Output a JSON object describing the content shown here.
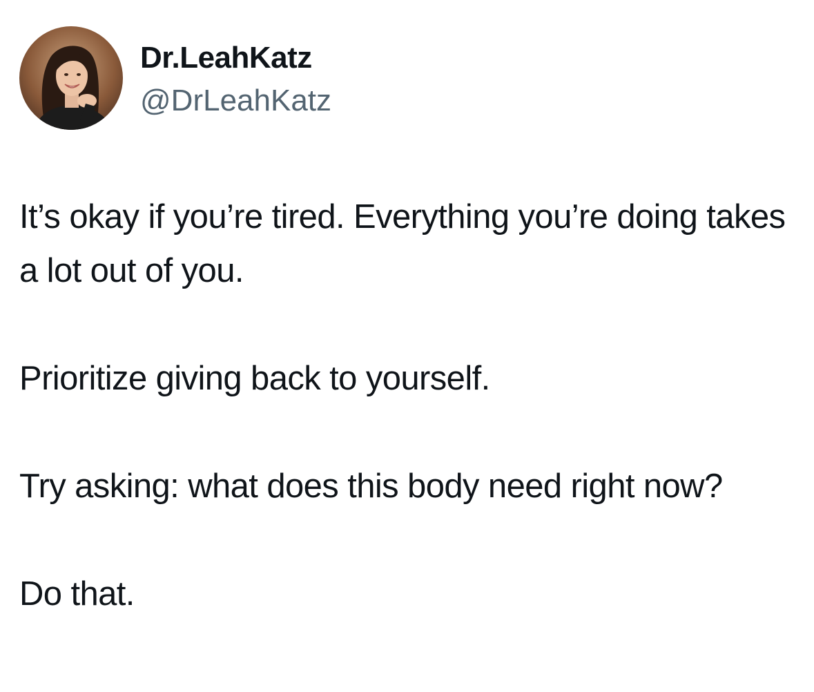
{
  "author": {
    "display_name": "Dr.LeahKatz",
    "handle": "@DrLeahKatz"
  },
  "tweet": {
    "paragraphs": [
      "It’s okay if you’re tired. Everything you’re doing takes a lot out of you.",
      "Prioritize giving back to yourself.",
      "Try asking: what does this body need right now?",
      "Do that."
    ]
  },
  "colors": {
    "text_primary": "#0f1419",
    "text_secondary": "#536471",
    "background": "#ffffff"
  }
}
